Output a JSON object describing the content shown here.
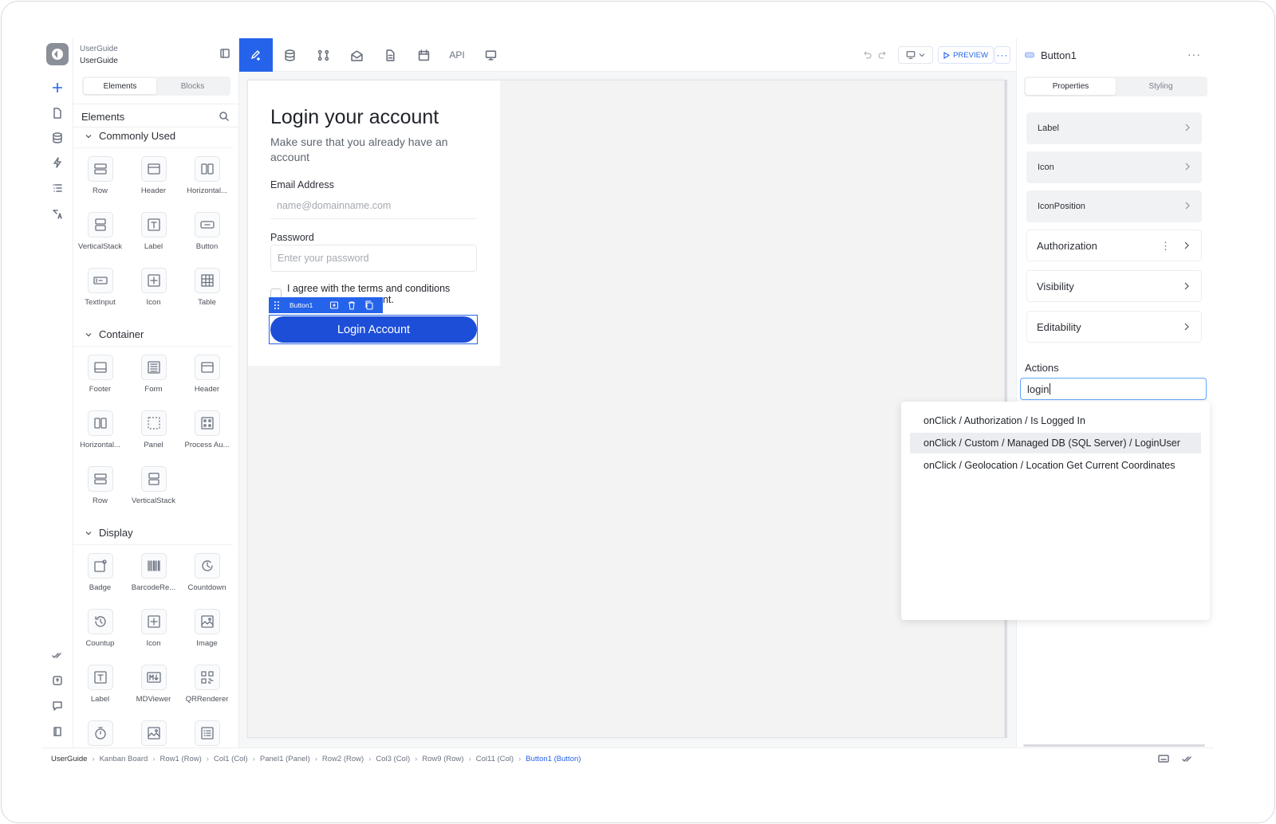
{
  "project": {
    "name": "UserGuide",
    "subtitle": "UserGuide"
  },
  "palette": {
    "tabs": [
      "Elements",
      "Blocks"
    ],
    "header": "Elements",
    "sections": [
      {
        "title": "Commonly Used",
        "items": [
          {
            "label": "Row",
            "icon": "row-icon"
          },
          {
            "label": "Header",
            "icon": "header-icon"
          },
          {
            "label": "Horizontal...",
            "icon": "horizontal-icon"
          },
          {
            "label": "VerticalStack",
            "icon": "vertical-stack-icon"
          },
          {
            "label": "Label",
            "icon": "label-icon"
          },
          {
            "label": "Button",
            "icon": "button-icon"
          },
          {
            "label": "TextInput",
            "icon": "text-input-icon"
          },
          {
            "label": "Icon",
            "icon": "plus-box-icon"
          },
          {
            "label": "Table",
            "icon": "table-icon"
          }
        ]
      },
      {
        "title": "Container",
        "items": [
          {
            "label": "Footer",
            "icon": "footer-icon"
          },
          {
            "label": "Form",
            "icon": "form-icon"
          },
          {
            "label": "Header",
            "icon": "header-icon"
          },
          {
            "label": "Horizontal...",
            "icon": "horizontal-icon"
          },
          {
            "label": "Panel",
            "icon": "panel-icon"
          },
          {
            "label": "Process Au...",
            "icon": "process-icon"
          },
          {
            "label": "Row",
            "icon": "row-icon"
          },
          {
            "label": "VerticalStack",
            "icon": "vertical-stack-icon"
          }
        ]
      },
      {
        "title": "Display",
        "items": [
          {
            "label": "Badge",
            "icon": "badge-icon"
          },
          {
            "label": "BarcodeRe...",
            "icon": "barcode-icon"
          },
          {
            "label": "Countdown",
            "icon": "countdown-icon"
          },
          {
            "label": "Countup",
            "icon": "countup-icon"
          },
          {
            "label": "Icon",
            "icon": "plus-box-icon"
          },
          {
            "label": "Image",
            "icon": "image-icon"
          },
          {
            "label": "Label",
            "icon": "label-icon"
          },
          {
            "label": "MDViewer",
            "icon": "markdown-icon"
          },
          {
            "label": "QRRenderer",
            "icon": "qr-icon"
          },
          {
            "label": "",
            "icon": "timer-icon"
          },
          {
            "label": "",
            "icon": "image-icon"
          },
          {
            "label": "",
            "icon": "list-icon"
          }
        ]
      }
    ]
  },
  "toolbar": {
    "api_label": "API",
    "preview_label": "PREVIEW"
  },
  "canvas": {
    "title": "Login your account",
    "subtitle": "Make sure that you already have an account",
    "email_label": "Email Address",
    "email_placeholder": "name@domainname.com",
    "password_label": "Password",
    "password_placeholder": "Enter your password",
    "agree_text": "I agree with the terms and conditions",
    "agree_text_hidden_tail": "unt.",
    "selected_component": "Button1",
    "login_button": "Login Account"
  },
  "properties": {
    "component": "Button1",
    "tabs": [
      "Properties",
      "Styling"
    ],
    "items": [
      "Label",
      "Icon",
      "IconPosition",
      "Authorization",
      "Visibility",
      "Editability"
    ],
    "actions_label": "Actions",
    "actions_search": "login",
    "suggestions": [
      "onClick / Authorization / Is Logged In",
      "onClick / Custom / Managed DB (SQL Server) / LoginUser",
      "onClick / Geolocation / Location Get Current Coordinates"
    ]
  },
  "breadcrumb": [
    "UserGuide",
    "Kanban Board",
    "Row1 (Row)",
    "Col1 (Col)",
    "Panel1 (Panel)",
    "Row2 (Row)",
    "Col3 (Col)",
    "Row9 (Row)",
    "Col11 (Col)",
    "Button1 (Button)"
  ],
  "colors": {
    "accent": "#2563eb",
    "button": "#1d4ed8"
  }
}
